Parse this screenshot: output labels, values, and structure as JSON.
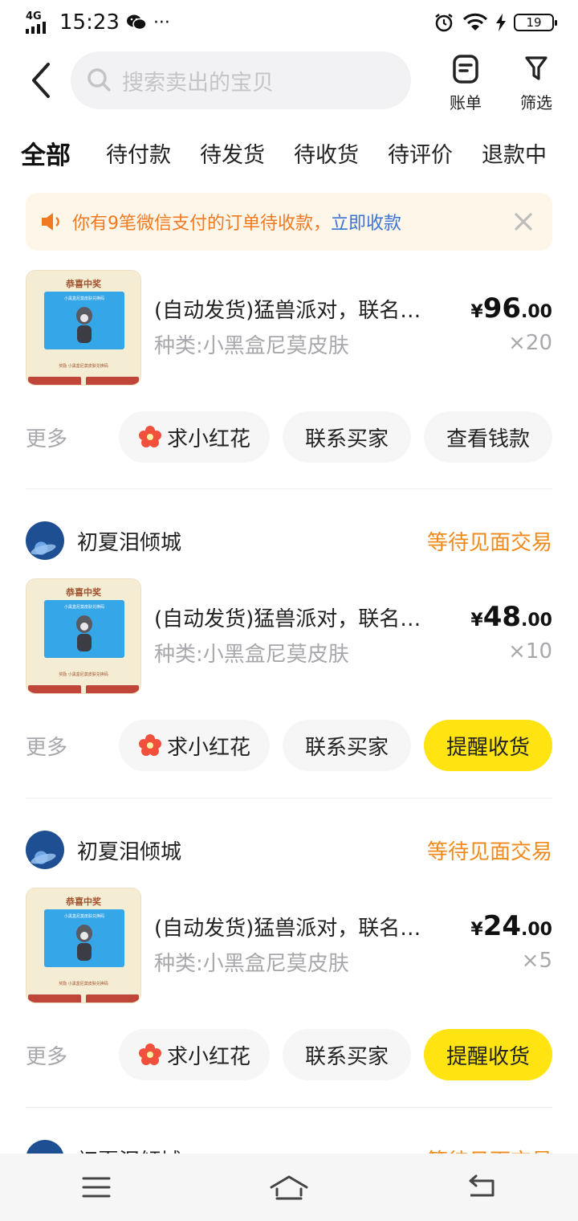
{
  "status_bar": {
    "network": "4G",
    "time": "15:23",
    "extra": "···",
    "battery": "19"
  },
  "header": {
    "search_placeholder": "搜索卖出的宝贝",
    "bill_label": "账单",
    "filter_label": "筛选"
  },
  "tabs": [
    {
      "label": "全部",
      "active": true
    },
    {
      "label": "待付款"
    },
    {
      "label": "待发货"
    },
    {
      "label": "待收货"
    },
    {
      "label": "待评价"
    },
    {
      "label": "退款中"
    }
  ],
  "notice": {
    "text": "你有9笔微信支付的订单待收款，",
    "link": "立即收款"
  },
  "orders": [
    {
      "seller": "",
      "status": "",
      "product": {
        "thumb_title": "恭喜中奖",
        "title": "(自动发货)猛兽派对，联名…",
        "sub": "种类:小黑盒尼莫皮肤",
        "price_currency": "¥",
        "price_int": "96",
        "price_dec": ".00",
        "qty": "×20"
      },
      "actions": {
        "more": "更多",
        "flower": "求小红花",
        "contact": "联系买家",
        "primary": "查看钱款"
      }
    },
    {
      "seller": "初夏泪倾城",
      "status": "等待见面交易",
      "product": {
        "thumb_title": "恭喜中奖",
        "title": "(自动发货)猛兽派对，联名…",
        "sub": "种类:小黑盒尼莫皮肤",
        "price_currency": "¥",
        "price_int": "48",
        "price_dec": ".00",
        "qty": "×10"
      },
      "actions": {
        "more": "更多",
        "flower": "求小红花",
        "contact": "联系买家",
        "primary": "提醒收货"
      }
    },
    {
      "seller": "初夏泪倾城",
      "status": "等待见面交易",
      "product": {
        "thumb_title": "恭喜中奖",
        "title": "(自动发货)猛兽派对，联名…",
        "sub": "种类:小黑盒尼莫皮肤",
        "price_currency": "¥",
        "price_int": "24",
        "price_dec": ".00",
        "qty": "×5"
      },
      "actions": {
        "more": "更多",
        "flower": "求小红花",
        "contact": "联系买家",
        "primary": "提醒收货"
      }
    },
    {
      "seller": "初夏泪倾城",
      "status": "等待见面交易"
    }
  ],
  "colors": {
    "accent_yellow": "#ffe411",
    "status_orange": "#f08a1c",
    "notice_orange": "#f07a22",
    "link_blue": "#3a73d6"
  }
}
